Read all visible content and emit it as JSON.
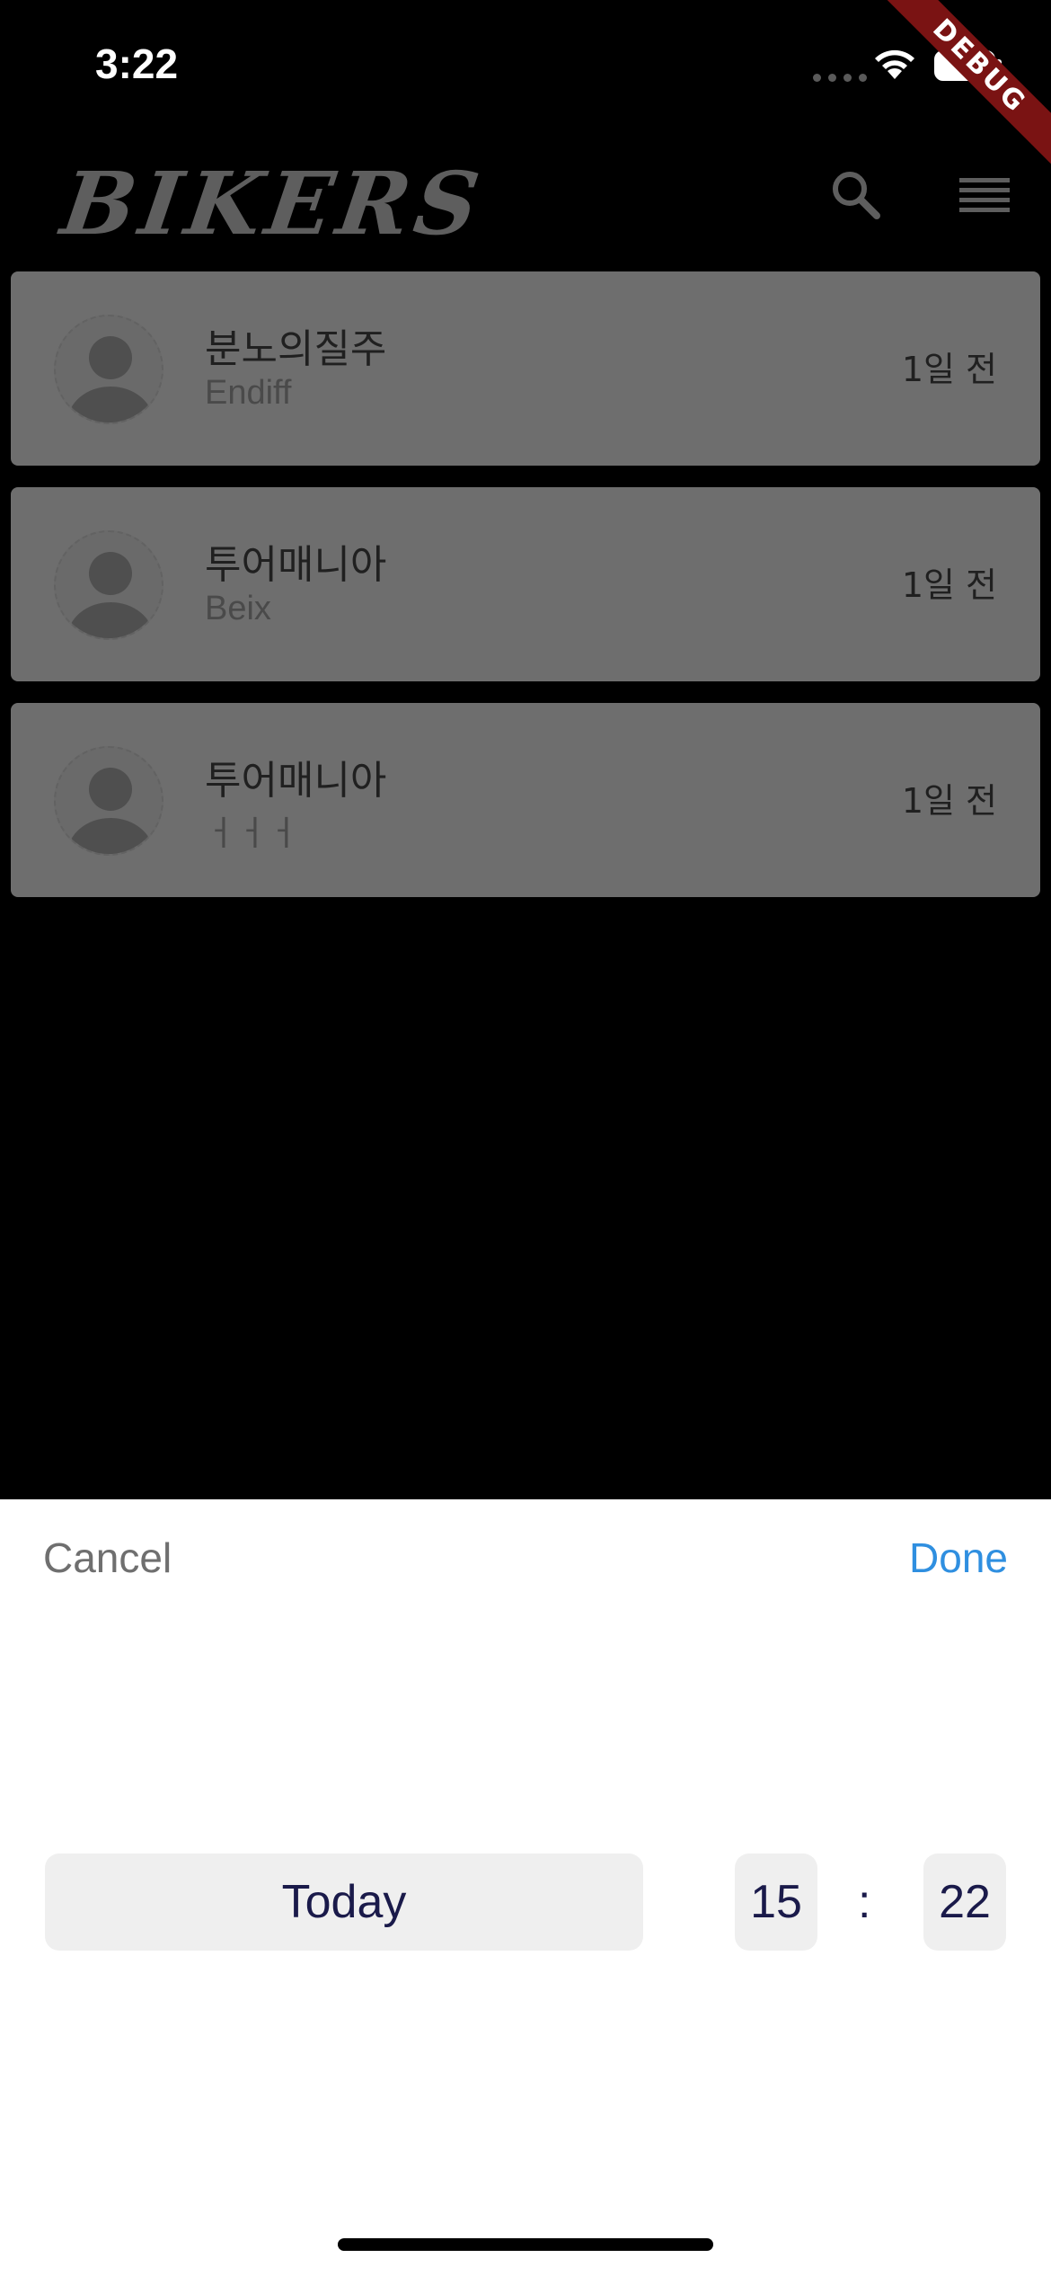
{
  "status_bar": {
    "time": "3:22"
  },
  "debug_ribbon": {
    "label": "DEBUG"
  },
  "header": {
    "logo": "BIKERS",
    "icons": [
      "search-icon",
      "menu-icon"
    ]
  },
  "chats": [
    {
      "title": "분노의질주",
      "preview": "Endiff",
      "time": "1일 전"
    },
    {
      "title": "투어매니아",
      "preview": "Beix",
      "time": "1일 전"
    },
    {
      "title": "투어매니아",
      "preview": "ㅓㅓㅓ",
      "time": "1일 전"
    }
  ],
  "picker": {
    "cancel_label": "Cancel",
    "done_label": "Done",
    "today_label": "Today",
    "hour": "15",
    "separator": ":",
    "minute": "22"
  },
  "colors": {
    "accent": "#2f8fe0",
    "card": "#6e6e6e",
    "debug": "#7a1313"
  }
}
